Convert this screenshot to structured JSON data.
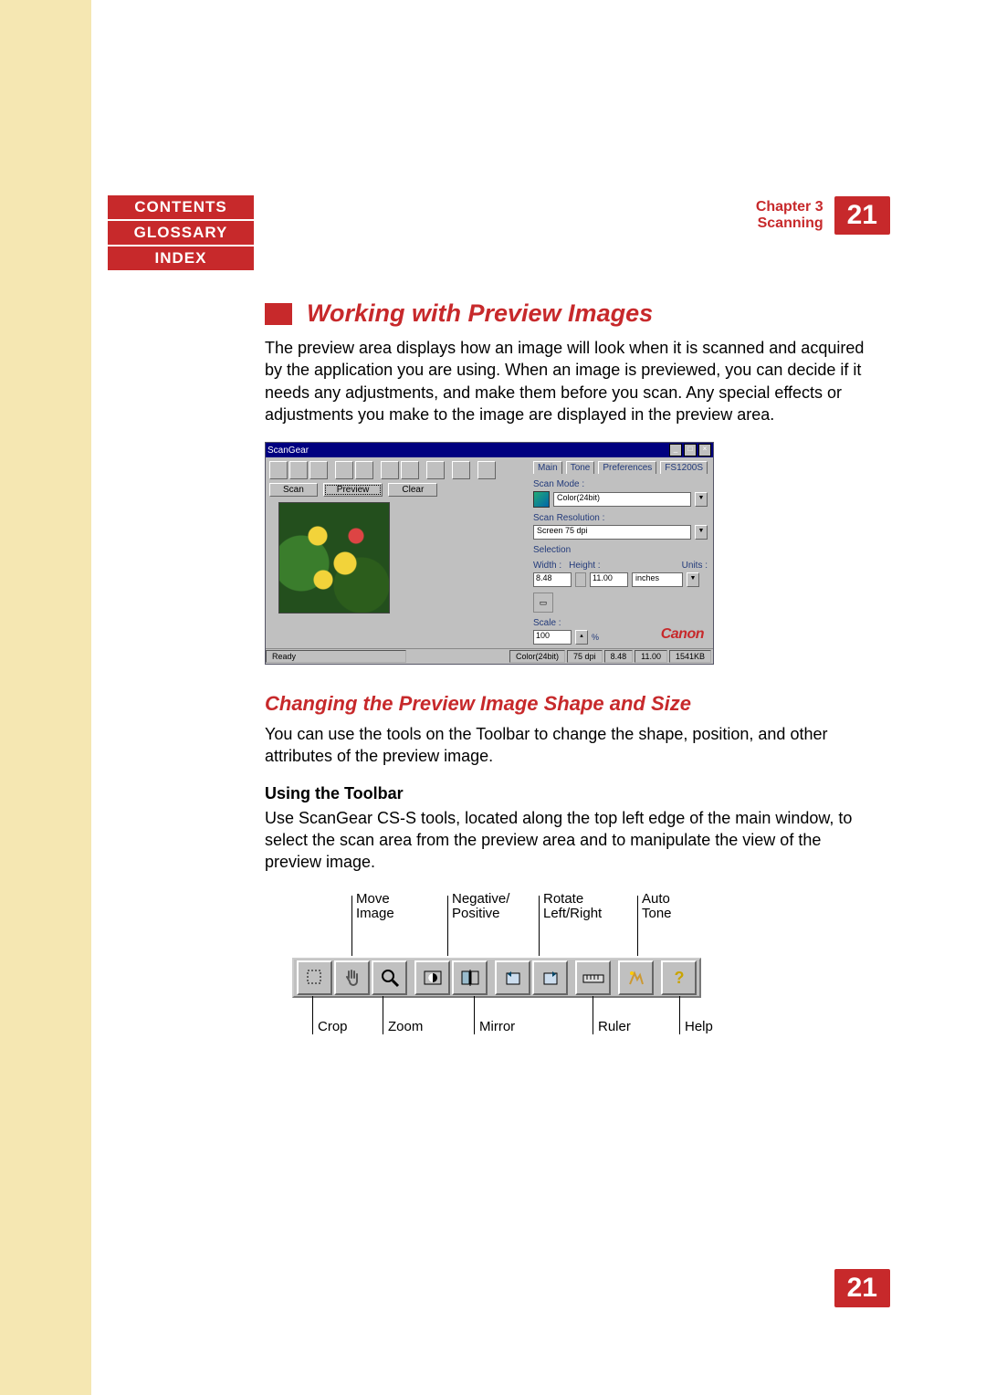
{
  "nav": {
    "contents": "CONTENTS",
    "glossary": "GLOSSARY",
    "index": "INDEX"
  },
  "chapter": {
    "line1": "Chapter 3",
    "line2": "Scanning",
    "page": "21"
  },
  "section": {
    "h1": "Working with Preview Images",
    "p1": "The preview area displays how an image will look when it is scanned and acquired by the application you are using. When an image is previewed, you can decide if it needs any adjustments, and make them before you scan. Any special effects or adjustments you make to the image are displayed in the preview area.",
    "h2": "Changing the Preview Image Shape and Size",
    "p2": "You can use the tools on the Toolbar to change the shape, position, and other attributes of the preview image.",
    "h3": "Using the Toolbar",
    "p3": "Use ScanGear CS-S tools, located along the top left edge of the main window, to select the scan area from the preview area and to manipulate the view of the preview image."
  },
  "app": {
    "title": "ScanGear",
    "buttons": {
      "scan": "Scan",
      "preview": "Preview",
      "clear": "Clear"
    },
    "tabs": {
      "main": "Main",
      "tone": "Tone",
      "preferences": "Preferences",
      "fs1200s": "FS1200S"
    },
    "labels": {
      "scan_mode": "Scan Mode :",
      "scan_resolution": "Scan Resolution :",
      "selection": "Selection",
      "width": "Width :",
      "height": "Height :",
      "units": "Units :",
      "scale": "Scale :"
    },
    "values": {
      "mode": "Color(24bit)",
      "resolution": "Screen 75 dpi",
      "width": "8.48",
      "height": "11.00",
      "units": "inches",
      "scale": "100"
    },
    "logo": "Canon",
    "status": {
      "ready": "Ready",
      "mode": "Color(24bit)",
      "dpi": "75 dpi",
      "w": "8.48",
      "h": "11.00",
      "size": "1541KB"
    }
  },
  "toolbar_labels": {
    "move_image": "Move\nImage",
    "negative_positive": "Negative/\nPositive",
    "rotate_lr": "Rotate\nLeft/Right",
    "auto_tone": "Auto\nTone",
    "crop": "Crop",
    "zoom": "Zoom",
    "mirror": "Mirror",
    "ruler": "Ruler",
    "help": "Help"
  },
  "footer_page": "21"
}
